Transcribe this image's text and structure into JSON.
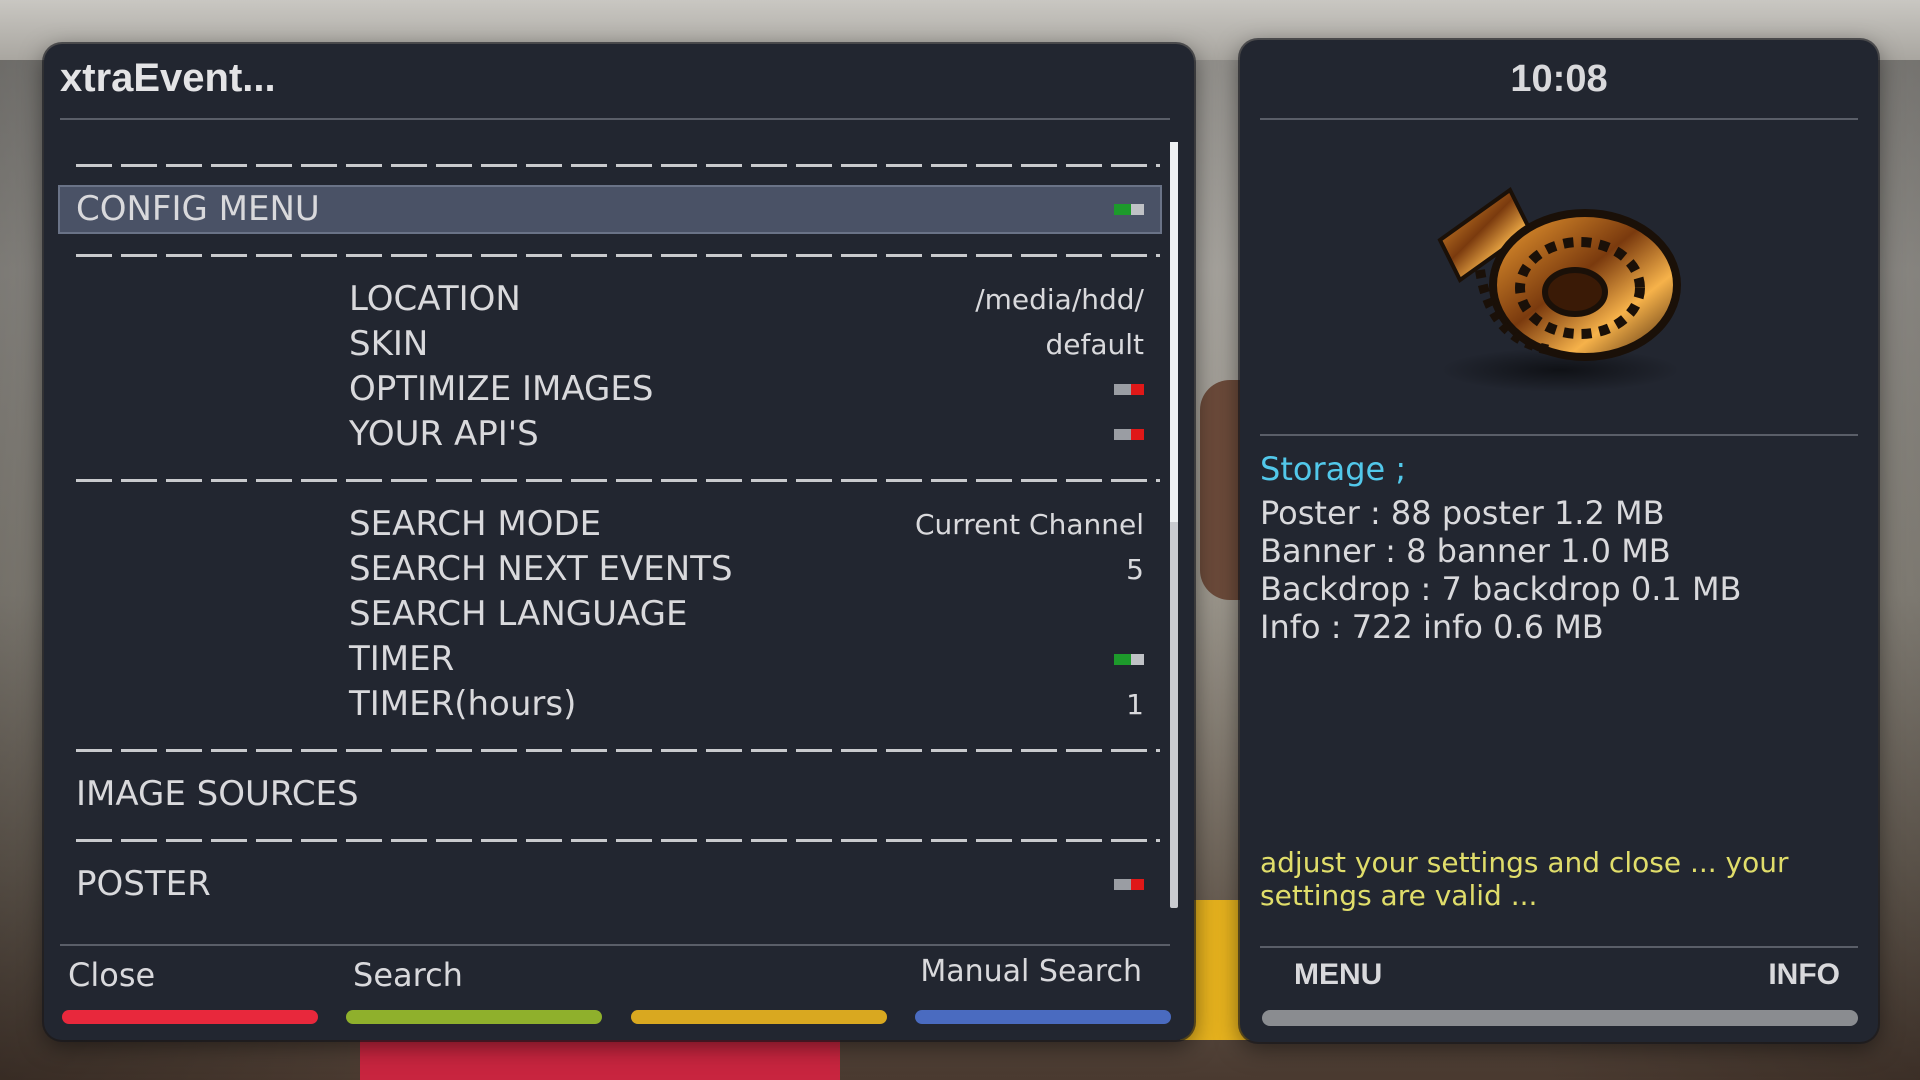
{
  "window": {
    "title": "xtraEvent..."
  },
  "menu": {
    "config_menu": {
      "label": "CONFIG MENU",
      "toggle": "on"
    },
    "location": {
      "label": "LOCATION",
      "value": "/media/hdd/"
    },
    "skin": {
      "label": "SKIN",
      "value": "default"
    },
    "optimize_images": {
      "label": "OPTIMIZE IMAGES",
      "toggle": "off"
    },
    "your_apis": {
      "label": "YOUR API'S",
      "toggle": "off"
    },
    "search_mode": {
      "label": "SEARCH MODE",
      "value": "Current Channel"
    },
    "search_next_events": {
      "label": "SEARCH NEXT EVENTS",
      "value": "5"
    },
    "search_language": {
      "label": "SEARCH LANGUAGE",
      "value": ""
    },
    "timer": {
      "label": "TIMER",
      "toggle": "on"
    },
    "timer_hours": {
      "label": "TIMER(hours)",
      "value": "1"
    },
    "image_sources": {
      "label": "IMAGE SOURCES"
    },
    "poster": {
      "label": "POSTER",
      "toggle": "off"
    }
  },
  "buttons": {
    "red": {
      "label": "Close",
      "color": "#e8283c"
    },
    "green": {
      "label": "Search",
      "color": "#8fb02c"
    },
    "yellow": {
      "label": "",
      "color": "#d9a820"
    },
    "blue": {
      "label": "Manual Search",
      "color": "#4a6bc0"
    }
  },
  "side": {
    "clock": "10:08",
    "storage_title": "Storage ;",
    "poster_line": "Poster : 88 poster 1.2 MB",
    "banner_line": "Banner : 8 banner 1.0 MB",
    "backdrop_line": "Backdrop : 7 backdrop 0.1 MB",
    "info_line": "Info : 722 info 0.6 MB",
    "status": "adjust your settings and close ... your settings are valid ...",
    "menu_button": "MENU",
    "info_button": "INFO",
    "icon": "film-reel-icon"
  },
  "colors": {
    "toggle_on": "#1d9a2b",
    "toggle_off": "#e01818",
    "accent_cyan": "#52c8ea",
    "status_yellow": "#e0dd6a"
  }
}
